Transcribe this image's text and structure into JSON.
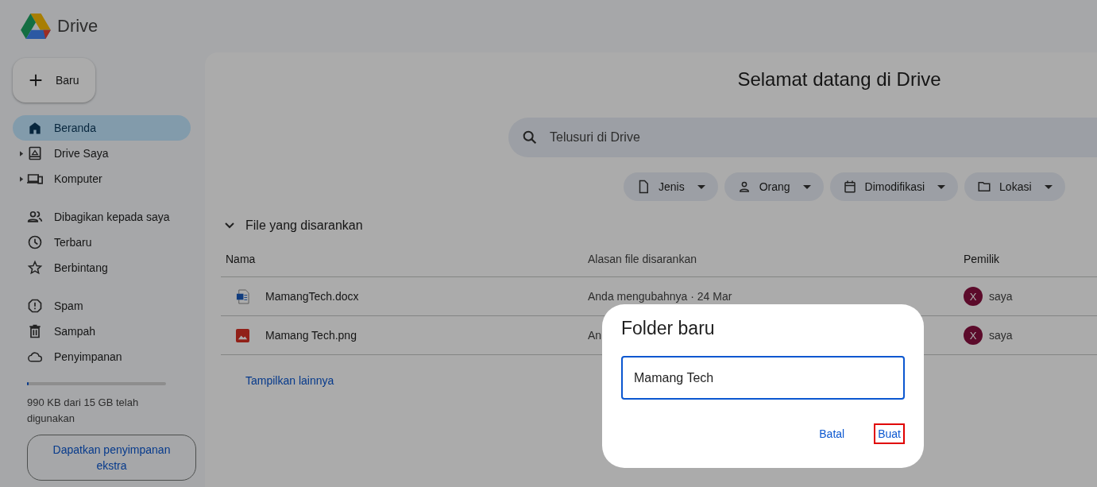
{
  "app": {
    "title": "Drive"
  },
  "new_button": {
    "label": "Baru"
  },
  "sidebar": {
    "sections": [
      [
        {
          "label": "Beranda",
          "selected": true,
          "expandable": false
        },
        {
          "label": "Drive Saya",
          "selected": false,
          "expandable": true
        },
        {
          "label": "Komputer",
          "selected": false,
          "expandable": true
        }
      ],
      [
        {
          "label": "Dibagikan kepada saya",
          "selected": false,
          "expandable": false
        },
        {
          "label": "Terbaru",
          "selected": false,
          "expandable": false
        },
        {
          "label": "Berbintang",
          "selected": false,
          "expandable": false
        }
      ],
      [
        {
          "label": "Spam",
          "selected": false,
          "expandable": false
        },
        {
          "label": "Sampah",
          "selected": false,
          "expandable": false
        },
        {
          "label": "Penyimpanan",
          "selected": false,
          "expandable": false
        }
      ]
    ],
    "storage": {
      "level": 0.01,
      "text": "990 KB dari 15 GB telah digunakan",
      "button": "Dapatkan penyimpanan ekstra"
    }
  },
  "main": {
    "title": "Selamat datang di Drive",
    "search": {
      "placeholder": "Telusuri di Drive"
    },
    "filters": [
      "Jenis",
      "Orang",
      "Dimodifikasi",
      "Lokasi"
    ],
    "section": {
      "title": "File yang disarankan",
      "expanded": true
    },
    "table": {
      "columns": [
        "Nama",
        "Alasan file disarankan",
        "Pemilik"
      ],
      "rows": [
        {
          "name": "MamangTech.docx",
          "kind": "doc",
          "reason": "Anda mengubahnya · 24 Mar",
          "owner_initial": "X",
          "owner": "saya"
        },
        {
          "name": "Mamang Tech.png",
          "kind": "image",
          "reason": "An",
          "owner_initial": "X",
          "owner": "saya"
        }
      ]
    },
    "more_link": "Tampilkan lainnya"
  },
  "dialog": {
    "title": "Folder baru",
    "value": "Mamang Tech",
    "buttons": [
      {
        "label": "Batal",
        "highlighted": false
      },
      {
        "label": "Buat",
        "highlighted": true
      }
    ]
  }
}
